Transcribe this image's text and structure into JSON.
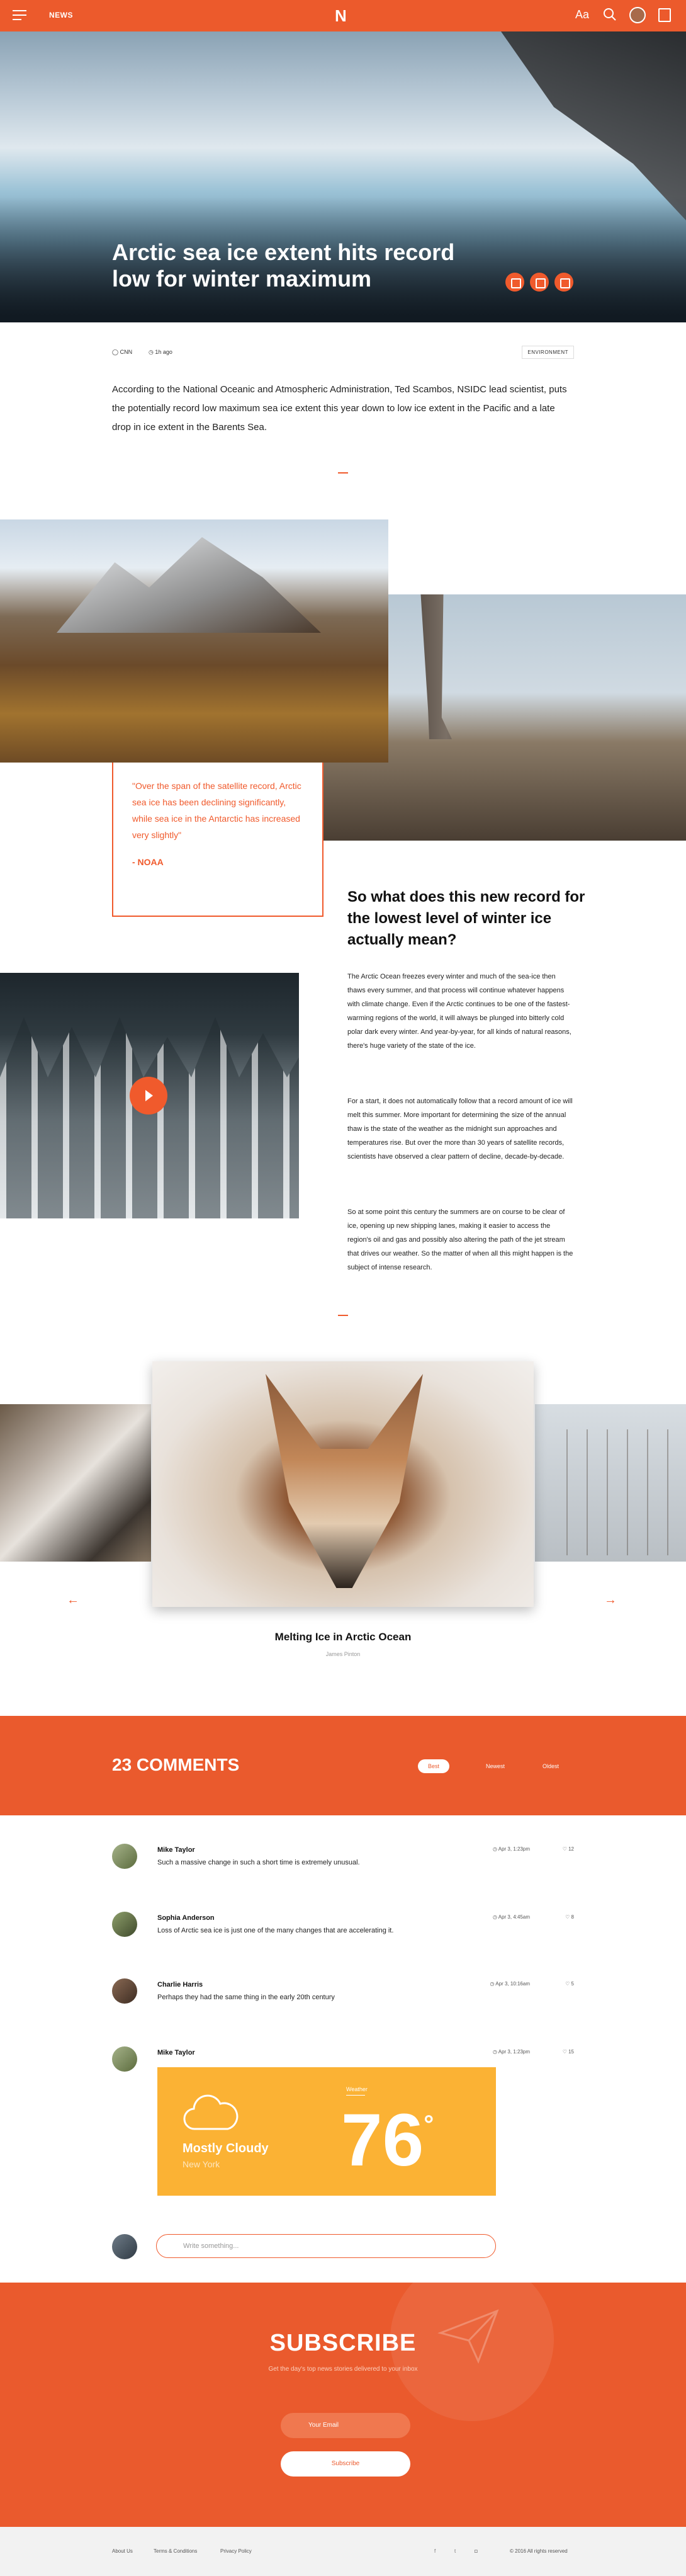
{
  "topbar": {
    "section": "NEWS",
    "logo": "N",
    "font_btn": "Aa"
  },
  "hero": {
    "title": "Arctic sea ice extent hits record low for winter maximum"
  },
  "meta": {
    "source": "CNN",
    "time": "1h ago",
    "category": "ENVIRONMENT"
  },
  "lead": "According to the National Oceanic and Atmospheric Administration, Ted Scambos, NSIDC lead scientist, puts the potentially record low maximum sea ice extent this year down to low ice extent in the Pacific and a late drop in ice extent in the Barents Sea.",
  "quote": {
    "text": "\"Over the span of the satellite record, Arctic sea ice has been declining significantly, while sea ice in the Antarctic has increased very slightly\"",
    "source": "- NOAA"
  },
  "section": {
    "title": "So what does this new record for the lowest level of winter ice actually mean?",
    "p1": "The Arctic Ocean freezes every winter and much of the sea-ice then thaws every summer, and that process will continue whatever happens with climate change. Even if the Arctic continues to be one of the fastest-warming regions of the world, it will always be plunged into bitterly cold polar dark every winter. And year-by-year, for all kinds of natural reasons, there's huge variety of the state of the ice.",
    "p2": "For a start, it does not automatically follow that a record amount of ice will melt this summer. More important for determining the size of the annual thaw is the state of the weather as the midnight sun approaches and temperatures rise. But over the more than 30 years of satellite records, scientists have observed a clear pattern of decline, decade-by-decade.",
    "p3": "So at some point this century the summers are on course to be clear of ice, opening up new shipping lanes, making it easier to access the region's oil and gas and possibly also altering the path of the jet stream that drives our weather. So the matter of when all this might happen is the subject of intense research."
  },
  "carousel": {
    "caption": "Melting Ice in Arctic Ocean",
    "author": "James Pinton",
    "prev": "←",
    "next": "→"
  },
  "comments": {
    "title": "23 COMMENTS",
    "sort": [
      "Best",
      "Newest",
      "Oldest"
    ],
    "items": [
      {
        "name": "Mike Taylor",
        "text": "Such a massive change in such a short time is extremely unusual.",
        "time": "Apr 3, 1:23pm",
        "likes": "12"
      },
      {
        "name": "Sophia Anderson",
        "text": "Loss of Arctic sea ice is just one of the many changes that are accelerating it.",
        "time": "Apr 3, 4:45am",
        "likes": "8"
      },
      {
        "name": "Charlie Harris",
        "text": "Perhaps they had the same thing in the early 20th century",
        "time": "Apr 3, 10:16am",
        "likes": "5"
      },
      {
        "name": "Mike Taylor",
        "text": "",
        "time": "Apr 3, 1:23pm",
        "likes": "15"
      }
    ],
    "write_placeholder": "Write something..."
  },
  "weather": {
    "label": "Weather",
    "condition": "Mostly Cloudy",
    "city": "New York",
    "temp": "76",
    "unit": "°"
  },
  "subscribe": {
    "title": "SUBSCRIBE",
    "subtitle": "Get the day's top news stories delivered to your inbox",
    "email_placeholder": "Your Email",
    "button": "Subscribe"
  },
  "footer": {
    "links": [
      "About Us",
      "Terms & Conditions",
      "Privacy Policy"
    ],
    "copyright": "© 2016 All rights reserved"
  },
  "colors": {
    "accent": "#ea5a2d",
    "weather": "#fbb234"
  }
}
